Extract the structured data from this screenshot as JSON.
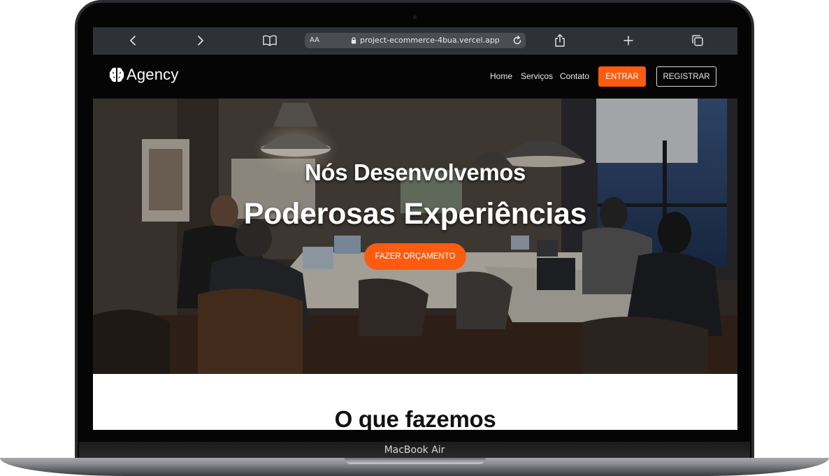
{
  "device": {
    "label": "MacBook Air"
  },
  "browser": {
    "url": "project-ecommerce-4bua.vercel.app",
    "text_size_label": "AA",
    "icons": [
      "chevron-left-icon",
      "chevron-right-icon",
      "book-icon",
      "lock-icon",
      "reload-icon",
      "share-icon",
      "plus-icon",
      "tabs-icon"
    ]
  },
  "site": {
    "brand": "Agency",
    "nav": {
      "home": "Home",
      "services": "Serviços",
      "contact": "Contato",
      "login": "ENTRAR",
      "register": "REGISTRAR"
    },
    "hero": {
      "subtitle": "Nós Desenvolvemos",
      "title": "Poderosas Experiências",
      "cta": "FAZER ORÇAMENTO"
    },
    "section_title": "O que fazemos"
  },
  "colors": {
    "accent": "#fc5b10",
    "nav_background": "#050505",
    "toolbar_background": "#2e3135"
  }
}
